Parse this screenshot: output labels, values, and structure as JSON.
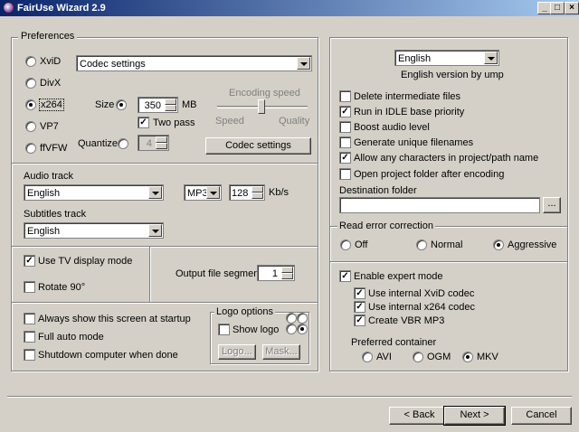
{
  "window": {
    "title": "FairUse Wizard 2.9",
    "min": "_",
    "max": "□",
    "close": "×"
  },
  "preferences": {
    "legend": "Preferences",
    "codecs": [
      {
        "label": "XviD",
        "selected": false
      },
      {
        "label": "DivX",
        "selected": false
      },
      {
        "label": "x264",
        "selected": true
      },
      {
        "label": "VP7",
        "selected": false
      },
      {
        "label": "ffVFW",
        "selected": false
      }
    ],
    "codec_settings_combo": "Codec settings",
    "size_label": "Size",
    "size_value": "350",
    "size_unit": "MB",
    "two_pass_label": "Two pass",
    "two_pass_checked": true,
    "quantizer_label": "Quantizer",
    "quantizer_value": "4",
    "encoding_speed_label": "Encoding speed",
    "speed_label": "Speed",
    "quality_label": "Quality",
    "encoding_speed_level": 0.5,
    "codec_settings_button": "Codec settings"
  },
  "audio": {
    "label": "Audio track",
    "track": "English",
    "codec": "MP3",
    "bitrate": "128",
    "unit": "Kb/s"
  },
  "subtitles": {
    "label": "Subtitles track",
    "track": "English"
  },
  "display": {
    "tv_mode_label": "Use TV display mode",
    "tv_mode_checked": true,
    "rotate_label": "Rotate 90°",
    "rotate_checked": false,
    "segments_label": "Output file segments",
    "segments_value": "1"
  },
  "startup": {
    "always_show": "Always show this screen at startup",
    "full_auto": "Full auto mode",
    "shutdown": "Shutdown computer when done"
  },
  "logo": {
    "legend": "Logo options",
    "show_logo": "Show logo",
    "logo_button": "Logo...",
    "mask_button": "Mask..."
  },
  "language": {
    "selected": "English",
    "credit": "English version by ump"
  },
  "options": [
    {
      "label": "Delete intermediate files",
      "checked": false
    },
    {
      "label": "Run in IDLE base priority",
      "checked": true
    },
    {
      "label": "Boost audio level",
      "checked": false
    },
    {
      "label": "Generate unique filenames",
      "checked": false
    },
    {
      "label": "Allow any characters in project/path name",
      "checked": true
    },
    {
      "label": "Open project folder after encoding",
      "checked": false
    }
  ],
  "destination": {
    "label": "Destination folder",
    "value": "",
    "browse": "..."
  },
  "read_error": {
    "legend": "Read error correction",
    "options": [
      {
        "label": "Off",
        "selected": false
      },
      {
        "label": "Normal",
        "selected": false
      },
      {
        "label": "Aggressive",
        "selected": true
      }
    ]
  },
  "expert": {
    "enable_label": "Enable expert mode",
    "enable_checked": true,
    "sub": [
      {
        "label": "Use internal XviD codec",
        "checked": true
      },
      {
        "label": "Use internal x264 codec",
        "checked": true
      },
      {
        "label": "Create VBR MP3",
        "checked": true
      }
    ],
    "container_label": "Preferred container",
    "containers": [
      {
        "label": "AVI",
        "selected": false
      },
      {
        "label": "OGM",
        "selected": false
      },
      {
        "label": "MKV",
        "selected": true
      }
    ]
  },
  "nav": {
    "back": "< Back",
    "next": "Next >",
    "cancel": "Cancel"
  }
}
